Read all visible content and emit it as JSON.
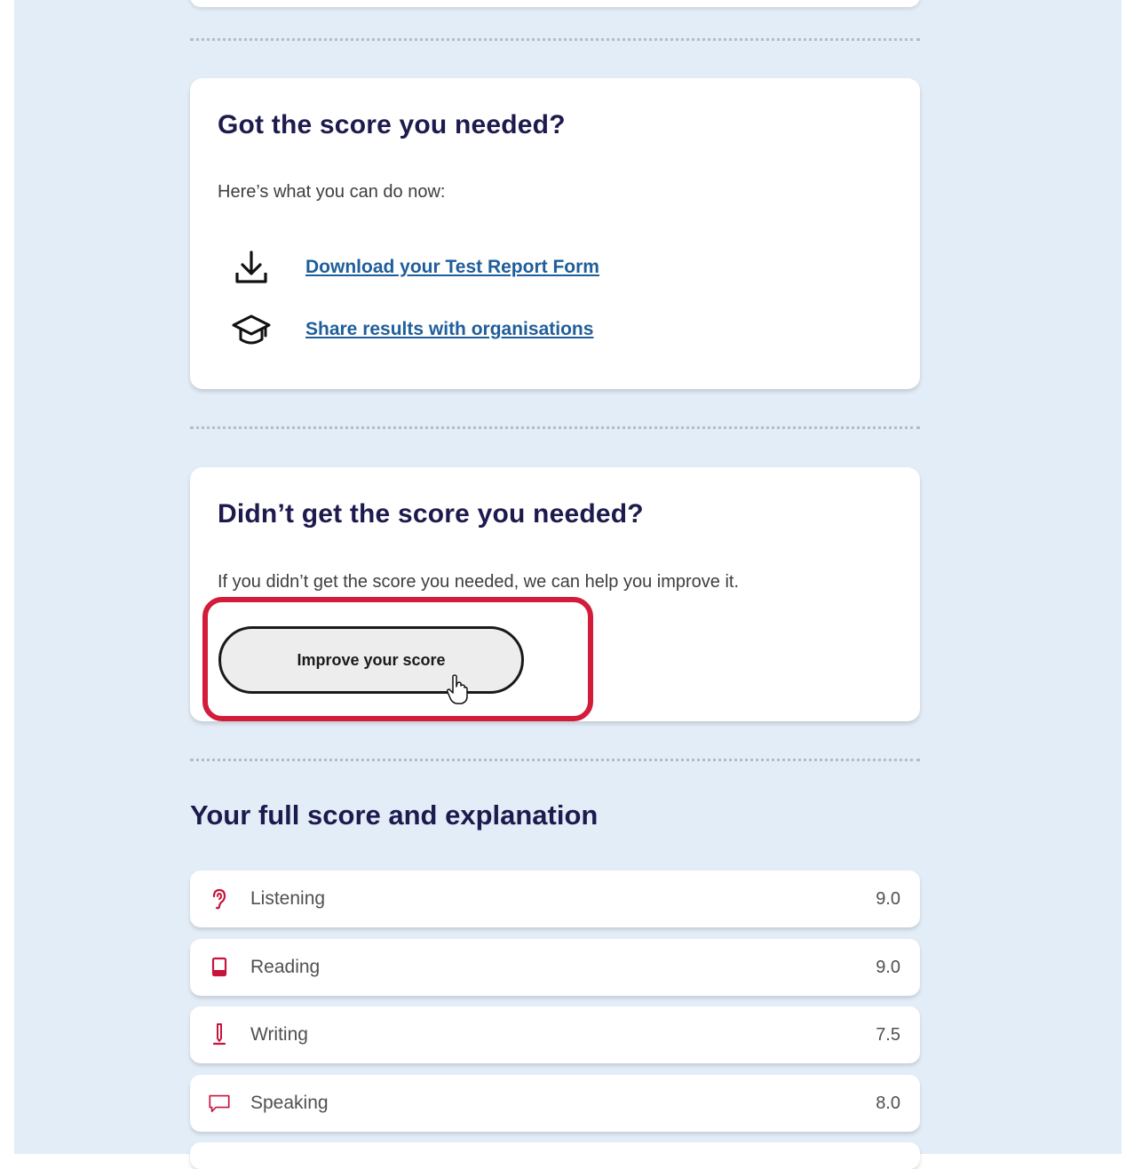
{
  "got_score": {
    "title": "Got the score you needed?",
    "subtitle": "Here’s what you can do now:",
    "actions": [
      {
        "label": "Download your Test Report Form",
        "icon": "download-icon"
      },
      {
        "label": "Share results with organisations",
        "icon": "graduation-cap-icon"
      }
    ]
  },
  "didnt_get_score": {
    "title": "Didn’t get the score you needed?",
    "description": "If you didn’t get the score you needed, we can help you improve it.",
    "button_label": "Improve your score"
  },
  "full_score": {
    "title": "Your full score and explanation",
    "rows": [
      {
        "label": "Listening",
        "score": "9.0",
        "icon": "ear-icon"
      },
      {
        "label": "Reading",
        "score": "9.0",
        "icon": "book-icon"
      },
      {
        "label": "Writing",
        "score": "7.5",
        "icon": "pen-icon"
      },
      {
        "label": "Speaking",
        "score": "8.0",
        "icon": "speech-bubble-icon"
      }
    ]
  },
  "colors": {
    "heading": "#1d1a4e",
    "link": "#1f5e9b",
    "page_background": "#e3edf7",
    "highlight": "#d31b3a",
    "skill_icon": "#c8143c"
  }
}
